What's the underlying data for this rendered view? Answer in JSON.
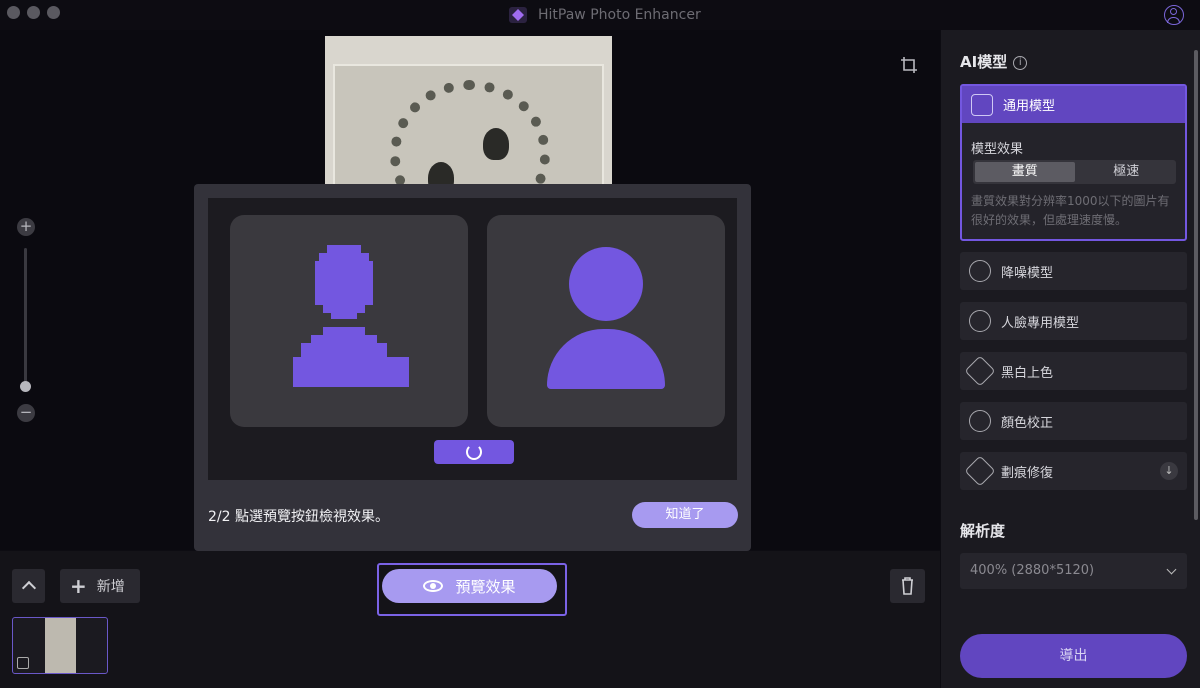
{
  "app": {
    "title": "HitPaw Photo Enhancer"
  },
  "modal": {
    "message": "2/2 點選預覽按鈕檢視效果。",
    "ok_label": "知道了"
  },
  "toolbar": {
    "add_label": "新增",
    "preview_label": "預覽效果"
  },
  "panel": {
    "ai_models_title": "AI模型",
    "selected_model": {
      "label": "通用模型",
      "effect_label": "模型效果",
      "segments": [
        "畫質",
        "極速"
      ],
      "active_segment": "畫質",
      "description": "畫質效果對分辨率1000以下的圖片有很好的效果，但處理速度慢。"
    },
    "models": [
      {
        "label": "降噪模型",
        "icon": "noise-icon"
      },
      {
        "label": "人臉專用模型",
        "icon": "face-icon"
      },
      {
        "label": "黑白上色",
        "icon": "colorize-icon"
      },
      {
        "label": "顏色校正",
        "icon": "color-correction-icon"
      },
      {
        "label": "劃痕修復",
        "icon": "scratch-repair-icon",
        "download": true
      }
    ],
    "resolution_title": "解析度",
    "resolution_value": "400% (2880*5120)",
    "export_label": "導出"
  },
  "colors": {
    "accent": "#7357e0",
    "accent_light": "#a79af0",
    "panel_bg": "#1b1a20",
    "canvas_bg": "#0b0a10"
  }
}
